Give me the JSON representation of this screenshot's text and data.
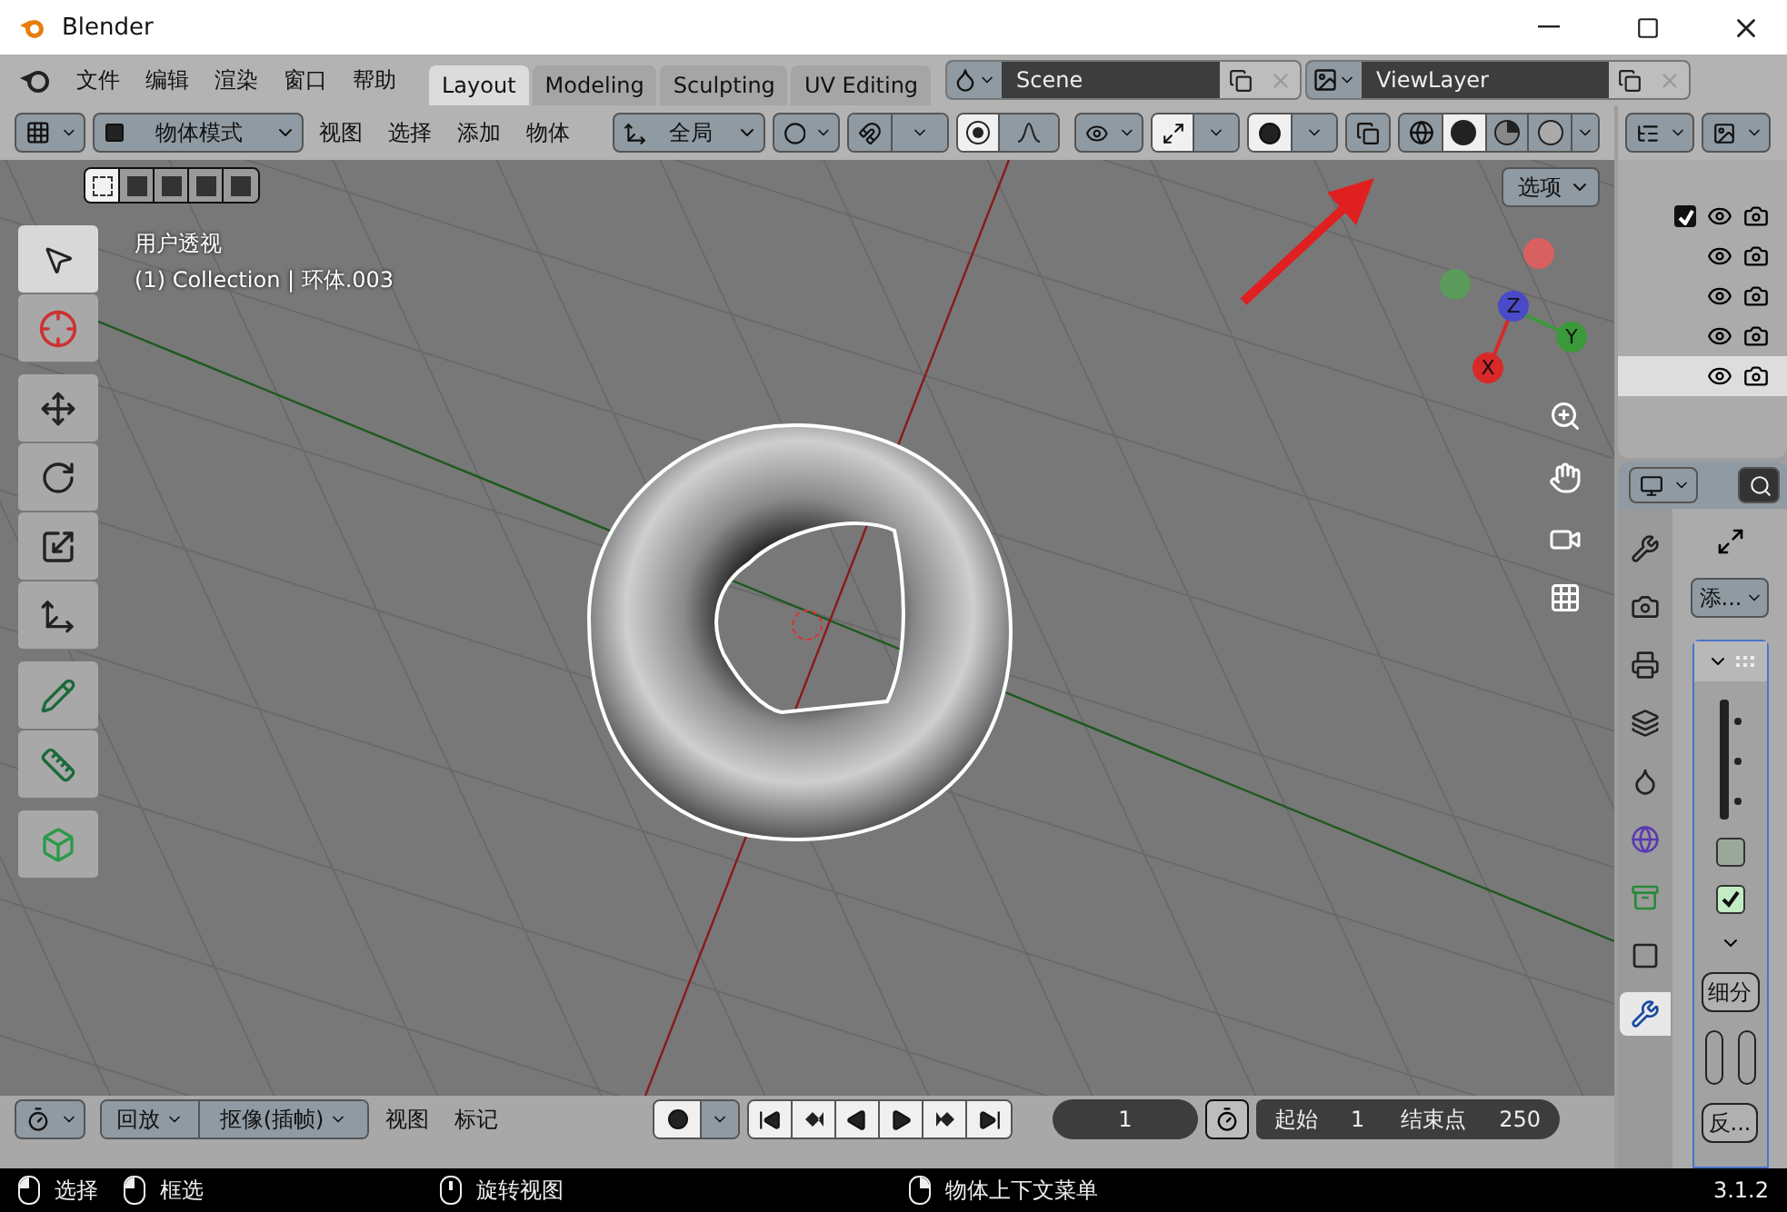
{
  "window": {
    "title": "Blender"
  },
  "menu": [
    "文件",
    "编辑",
    "渲染",
    "窗口",
    "帮助"
  ],
  "workspaces": [
    {
      "label": "Layout",
      "selected": true
    },
    {
      "label": "Modeling",
      "selected": false
    },
    {
      "label": "Sculpting",
      "selected": false
    },
    {
      "label": "UV Editing",
      "selected": false
    }
  ],
  "scene": {
    "value": "Scene"
  },
  "view_layer": {
    "value": "ViewLayer"
  },
  "viewport_header": {
    "mode": "物体模式",
    "menus": [
      "视图",
      "选择",
      "添加",
      "物体"
    ],
    "orientation": "全局",
    "xray": false
  },
  "shading_modes": [
    {
      "kind": "wireframe",
      "selected": false
    },
    {
      "kind": "solid",
      "selected": true
    },
    {
      "kind": "material",
      "selected": false
    },
    {
      "kind": "rendered",
      "selected": false
    }
  ],
  "select_modes": [
    {
      "selected": true
    },
    {
      "selected": false
    },
    {
      "selected": false
    },
    {
      "selected": false
    },
    {
      "selected": false
    }
  ],
  "viewport": {
    "view_name": "用户透视",
    "object_info": "(1) Collection | 环体.003",
    "options": "选项"
  },
  "tools": [
    {
      "kind": "select",
      "selected": true
    },
    {
      "kind": "cursor",
      "selected": false
    },
    {
      "kind": "move",
      "selected": false
    },
    {
      "kind": "rotate",
      "selected": false
    },
    {
      "kind": "scale",
      "selected": false
    },
    {
      "kind": "transform",
      "selected": false
    },
    {
      "kind": "annotate",
      "selected": false
    },
    {
      "kind": "measure",
      "selected": false
    },
    {
      "kind": "add_cube",
      "selected": false
    }
  ],
  "gizmo_axes": [
    {
      "label": "Z",
      "color": "#4a4ac8"
    },
    {
      "label": "Y",
      "color": "#3a9a3a"
    },
    {
      "label": "X",
      "color": "#d82828"
    }
  ],
  "outliner": {
    "rows": [
      {
        "kind": "collection",
        "checked": true,
        "selected": false
      },
      {
        "kind": "object",
        "selected": false
      },
      {
        "kind": "object",
        "selected": false
      },
      {
        "kind": "object",
        "selected": false
      },
      {
        "kind": "object",
        "selected": true
      }
    ]
  },
  "properties": {
    "tabs": [
      {
        "kind": "tool",
        "selected": false
      },
      {
        "kind": "render",
        "selected": false
      },
      {
        "kind": "output",
        "selected": false
      },
      {
        "kind": "view_layer",
        "selected": false
      },
      {
        "kind": "scene",
        "selected": false
      },
      {
        "kind": "world",
        "selected": false
      },
      {
        "kind": "collection",
        "selected": false
      },
      {
        "kind": "object",
        "selected": false
      },
      {
        "kind": "modifier",
        "selected": true
      }
    ],
    "add_modifier": "添...",
    "checkboxes": [
      {
        "checked": false
      },
      {
        "checked": true
      }
    ],
    "subdivide": "细分",
    "apply": "反..."
  },
  "timeline": {
    "playback": "回放",
    "keying": "抠像(插帧)",
    "menus": [
      "视图",
      "标记"
    ],
    "current_frame": "1",
    "start_label": "起始",
    "start": "1",
    "end_label": "结束点",
    "end": "250"
  },
  "status_bar": {
    "hints": [
      {
        "kind": "left",
        "label": "选择"
      },
      {
        "kind": "drag",
        "label": "框选"
      },
      {
        "kind": "middle",
        "label": "旋转视图"
      },
      {
        "kind": "right",
        "label": "物体上下文菜单"
      }
    ],
    "version": "3.1.2"
  }
}
